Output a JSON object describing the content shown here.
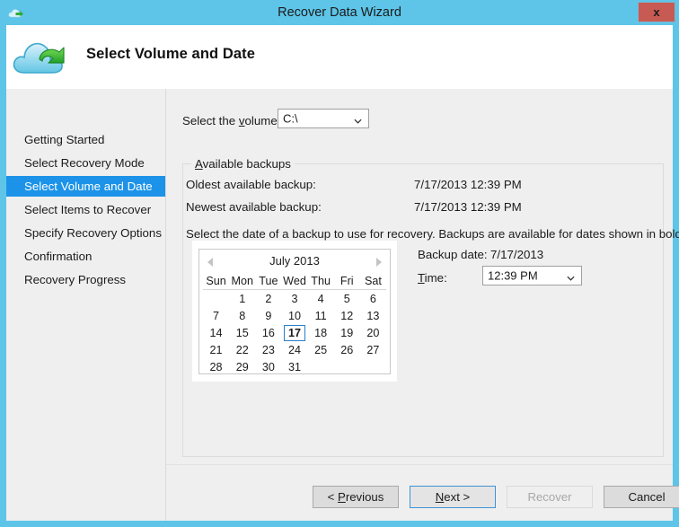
{
  "window": {
    "title": "Recover Data Wizard",
    "icon": "cloud-recovery-icon",
    "close_label": "x"
  },
  "header": {
    "title": "Select Volume and Date",
    "icon": "cloud-recovery-icon"
  },
  "sidebar": {
    "items": [
      {
        "label": "Getting Started",
        "active": false
      },
      {
        "label": "Select Recovery Mode",
        "active": false
      },
      {
        "label": "Select Volume and Date",
        "active": true
      },
      {
        "label": "Select Items to Recover",
        "active": false
      },
      {
        "label": "Specify Recovery Options",
        "active": false
      },
      {
        "label": "Confirmation",
        "active": false
      },
      {
        "label": "Recovery Progress",
        "active": false
      }
    ]
  },
  "main": {
    "volume_label_pre": "Select the ",
    "volume_label_key": "v",
    "volume_label_post": "olume:",
    "volume_value": "C:\\",
    "group_title_key": "A",
    "group_title_rest": "vailable backups",
    "oldest_label": "Oldest available backup:",
    "oldest_value": "7/17/2013 12:39 PM",
    "newest_label": "Newest available backup:",
    "newest_value": "7/17/2013 12:39 PM",
    "instruction": "Select the date of a backup to use for recovery. Backups are available for dates shown in bold.",
    "backup_date_label": "Backup date:",
    "backup_date_value": "7/17/2013",
    "time_label_key": "T",
    "time_label_rest": "ime:",
    "time_value": "12:39 PM"
  },
  "calendar": {
    "month_title": "July 2013",
    "prev_icon": "triangle-left-icon",
    "next_icon": "triangle-right-icon",
    "weekdays": [
      "Sun",
      "Mon",
      "Tue",
      "Wed",
      "Thu",
      "Fri",
      "Sat"
    ],
    "weeks": [
      [
        "",
        "1",
        "2",
        "3",
        "4",
        "5",
        "6"
      ],
      [
        "7",
        "8",
        "9",
        "10",
        "11",
        "12",
        "13"
      ],
      [
        "14",
        "15",
        "16",
        "17",
        "18",
        "19",
        "20"
      ],
      [
        "21",
        "22",
        "23",
        "24",
        "25",
        "26",
        "27"
      ],
      [
        "28",
        "29",
        "30",
        "31",
        "",
        "",
        ""
      ]
    ],
    "selected_day": "17"
  },
  "buttons": {
    "previous_pre": "< ",
    "previous_key": "P",
    "previous_rest": "revious",
    "next_key": "N",
    "next_rest": "ext >",
    "recover": "Recover",
    "cancel": "Cancel"
  },
  "colors": {
    "titlebar": "#5ec5e8",
    "accent_selected": "#1c93e8",
    "close_button": "#c75b53",
    "dialog_face": "#efefef"
  }
}
